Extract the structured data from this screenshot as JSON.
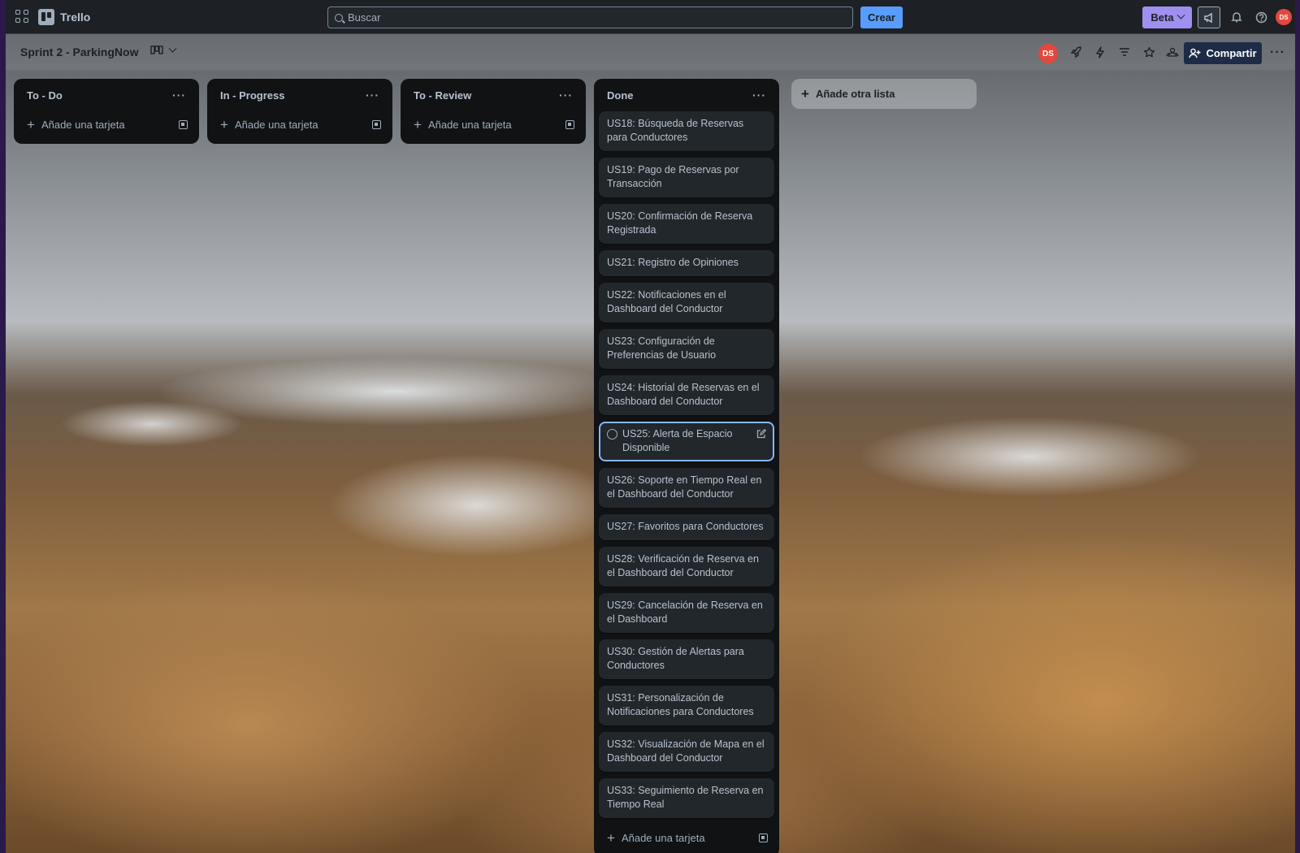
{
  "app": {
    "name": "Trello",
    "search_placeholder": "Buscar",
    "create_label": "Crear",
    "beta_label": "Beta",
    "user_initials": "DS"
  },
  "board": {
    "title": "Sprint 2 - ParkingNow",
    "share_label": "Compartir",
    "member_initials": "DS",
    "add_list_label": "Añade otra lista"
  },
  "lists": [
    {
      "title": "To - Do",
      "add_card_label": "Añade una tarjeta",
      "cards": []
    },
    {
      "title": "In - Progress",
      "add_card_label": "Añade una tarjeta",
      "cards": []
    },
    {
      "title": "To - Review",
      "add_card_label": "Añade una tarjeta",
      "cards": []
    },
    {
      "title": "Done",
      "add_card_label": "Añade una tarjeta",
      "cards": [
        "US18: Búsqueda de Reservas para Conductores",
        "US19: Pago de Reservas por Transacción",
        "US20: Confirmación de Reserva Registrada",
        "US21: Registro de Opiniones",
        "US22: Notificaciones en el Dashboard del Conductor",
        "US23: Configuración de Preferencias de Usuario",
        "US24: Historial de Reservas en el Dashboard del Conductor",
        "US25: Alerta de Espacio Disponible",
        "US26: Soporte en Tiempo Real en el Dashboard del Conductor",
        "US27: Favoritos para Conductores",
        "US28: Verificación de Reserva en el Dashboard del Conductor",
        "US29: Cancelación de Reserva en el Dashboard",
        "US30: Gestión de Alertas para Conductores",
        "US31: Personalización de Notificaciones para Conductores",
        "US32: Visualización de Mapa en el Dashboard del Conductor",
        "US33: Seguimiento de Reserva en Tiempo Real"
      ],
      "focused_card_index": 7
    }
  ],
  "colors": {
    "accent_blue": "#579dff",
    "beta_purple": "#9f8fef",
    "avatar_red": "#e2483d",
    "list_bg": "#101214",
    "card_bg": "#22272b"
  }
}
